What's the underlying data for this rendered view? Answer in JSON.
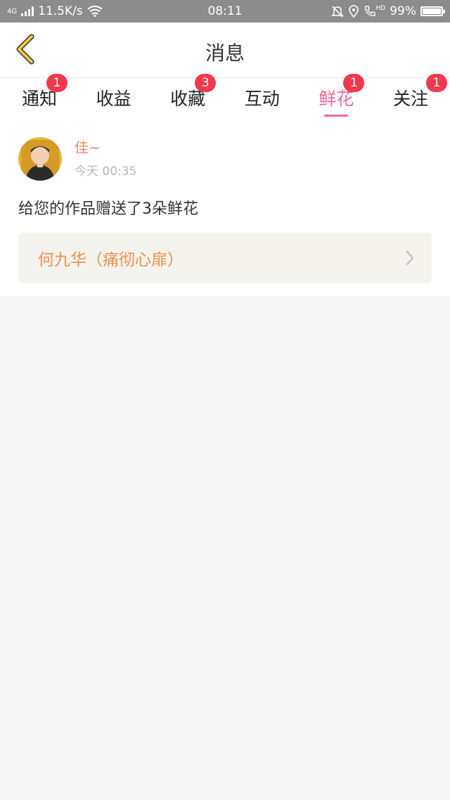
{
  "statusbar": {
    "network": "4G",
    "speed": "11.5K/s",
    "time": "08:11",
    "hd": "HD",
    "battery": "99%",
    "battery_level": 0.99
  },
  "header": {
    "title": "消息"
  },
  "tabs": [
    {
      "label": "通知",
      "badge": "1"
    },
    {
      "label": "收益",
      "badge": ""
    },
    {
      "label": "收藏",
      "badge": "3"
    },
    {
      "label": "互动",
      "badge": ""
    },
    {
      "label": "鲜花",
      "badge": "1",
      "active": true
    },
    {
      "label": "关注",
      "badge": "1"
    }
  ],
  "message": {
    "username": "佳~",
    "time": "今天 00:35",
    "text": "给您的作品赠送了3朵鲜花",
    "work_title": "何九华（痛彻心扉）"
  },
  "colors": {
    "accent": "#f0659a",
    "badge": "#f0394c",
    "back_arrow": "#f2c84b",
    "work_title": "#f0904f",
    "username": "#f08a6a"
  }
}
